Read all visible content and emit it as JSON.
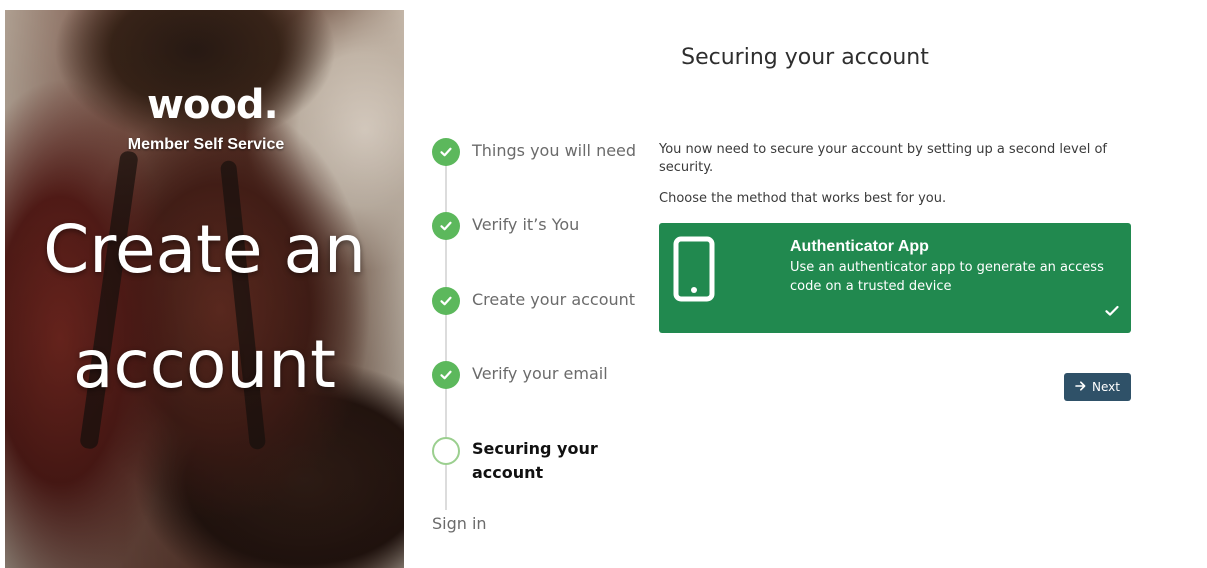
{
  "hero": {
    "logo_text": "wood.",
    "subtitle": "Member Self Service",
    "title_line1": "Create an",
    "title_line2": "account"
  },
  "steps": [
    {
      "label": "Things you will need",
      "status": "done",
      "icon": "check-icon"
    },
    {
      "label": "Verify it’s You",
      "status": "done",
      "icon": "check-icon"
    },
    {
      "label": "Create your account",
      "status": "done",
      "icon": "check-icon"
    },
    {
      "label": "Verify your email",
      "status": "done",
      "icon": "check-icon"
    },
    {
      "label": "Securing your account",
      "status": "current",
      "icon": "empty-circle-icon"
    }
  ],
  "signin_label": "Sign in",
  "main": {
    "title": "Securing your account",
    "intro": "You now need to secure your account by setting up a second level of security.",
    "choose": "Choose the method that works best for you.",
    "option": {
      "title": "Authenticator App",
      "description": "Use an authenticator app to generate an access code on a trusted device",
      "selected": true,
      "icon": "smartphone-icon"
    },
    "next_label": "Next"
  },
  "colors": {
    "step_done": "#5cb85c",
    "option_bg": "#21894f",
    "next_bg": "#2f5168"
  }
}
